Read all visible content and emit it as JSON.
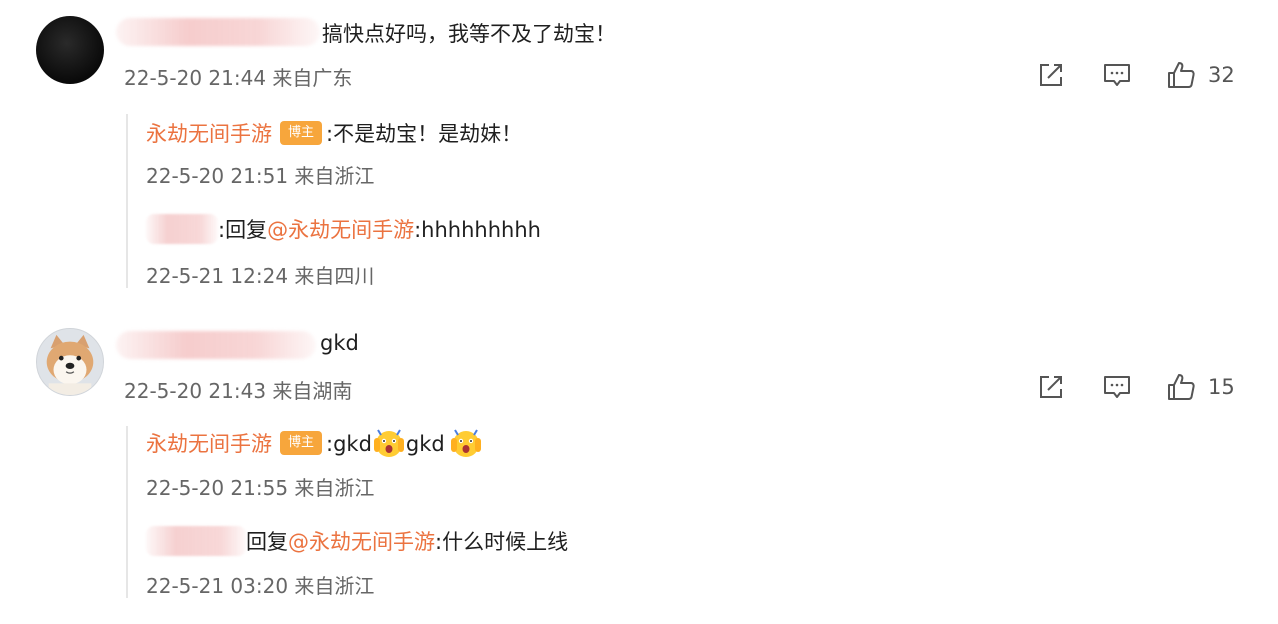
{
  "comments": [
    {
      "text": "搞快点好吗，我等不及了劫宝！",
      "time": "22-5-20 21:44",
      "location": "来自广东",
      "likes": "32",
      "replies": [
        {
          "author": "永劫无间手游",
          "badge": "博主",
          "text": ":不是劫宝！是劫妹！",
          "time": "22-5-20 21:51",
          "location": "来自浙江"
        },
        {
          "reply_prefix": ":回复",
          "mention": "@永劫无间手游",
          "text": ":hhhhhhhhh",
          "time": "22-5-21 12:24",
          "location": "来自四川"
        }
      ]
    },
    {
      "text": "gkd",
      "time": "22-5-20 21:43",
      "location": "来自湖南",
      "likes": "15",
      "replies": [
        {
          "author": "永劫无间手游",
          "badge": "博主",
          "text1": ":gkd",
          "text2": "gkd",
          "time": "22-5-20 21:55",
          "location": "来自浙江"
        },
        {
          "reply_prefix": "回复",
          "mention": "@永劫无间手游",
          "text": ":什么时候上线",
          "time": "22-5-21 03:20",
          "location": "来自浙江"
        }
      ]
    }
  ],
  "icons": {
    "share": "share-icon",
    "comment": "comment-icon",
    "like": "thumbs-up-icon",
    "emoji": "screaming-face-emoji-icon"
  },
  "colors": {
    "author": "#eb7340",
    "badge": "#f7a63c",
    "meta": "#666666",
    "text": "#1f1f1f"
  }
}
